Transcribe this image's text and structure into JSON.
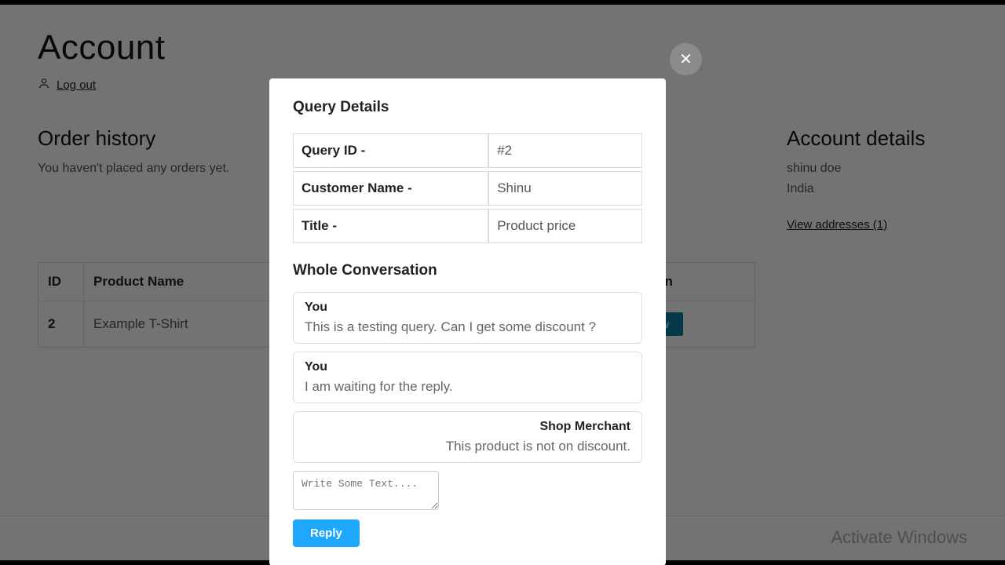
{
  "page": {
    "title": "Account",
    "logout_label": "Log out"
  },
  "order_history": {
    "title": "Order history",
    "empty_text": "You haven't placed any orders yet."
  },
  "account_details": {
    "title": "Account details",
    "name": "shinu doe",
    "country": "India",
    "view_addresses": "View addresses (1)"
  },
  "table": {
    "headers": {
      "id": "ID",
      "product": "Product Name",
      "action": "Action"
    },
    "rows": [
      {
        "id": "2",
        "product": "Example T-Shirt",
        "action_label": "View"
      }
    ]
  },
  "modal": {
    "title": "Query Details",
    "fields": {
      "query_id_label": "Query ID -",
      "query_id_value": "#2",
      "customer_label": "Customer Name -",
      "customer_value": "Shinu",
      "title_label": "Title -",
      "title_value": "Product price"
    },
    "conversation_title": "Whole Conversation",
    "messages": [
      {
        "who": "You",
        "text": "This is a testing query. Can I get some discount ?",
        "side": "left"
      },
      {
        "who": "You",
        "text": "I am waiting for the reply.",
        "side": "left"
      },
      {
        "who": "Shop Merchant",
        "text": "This product is not on discount.",
        "side": "right"
      }
    ],
    "reply_placeholder": "Write Some Text....",
    "reply_button": "Reply"
  },
  "watermark": "Activate Windows"
}
